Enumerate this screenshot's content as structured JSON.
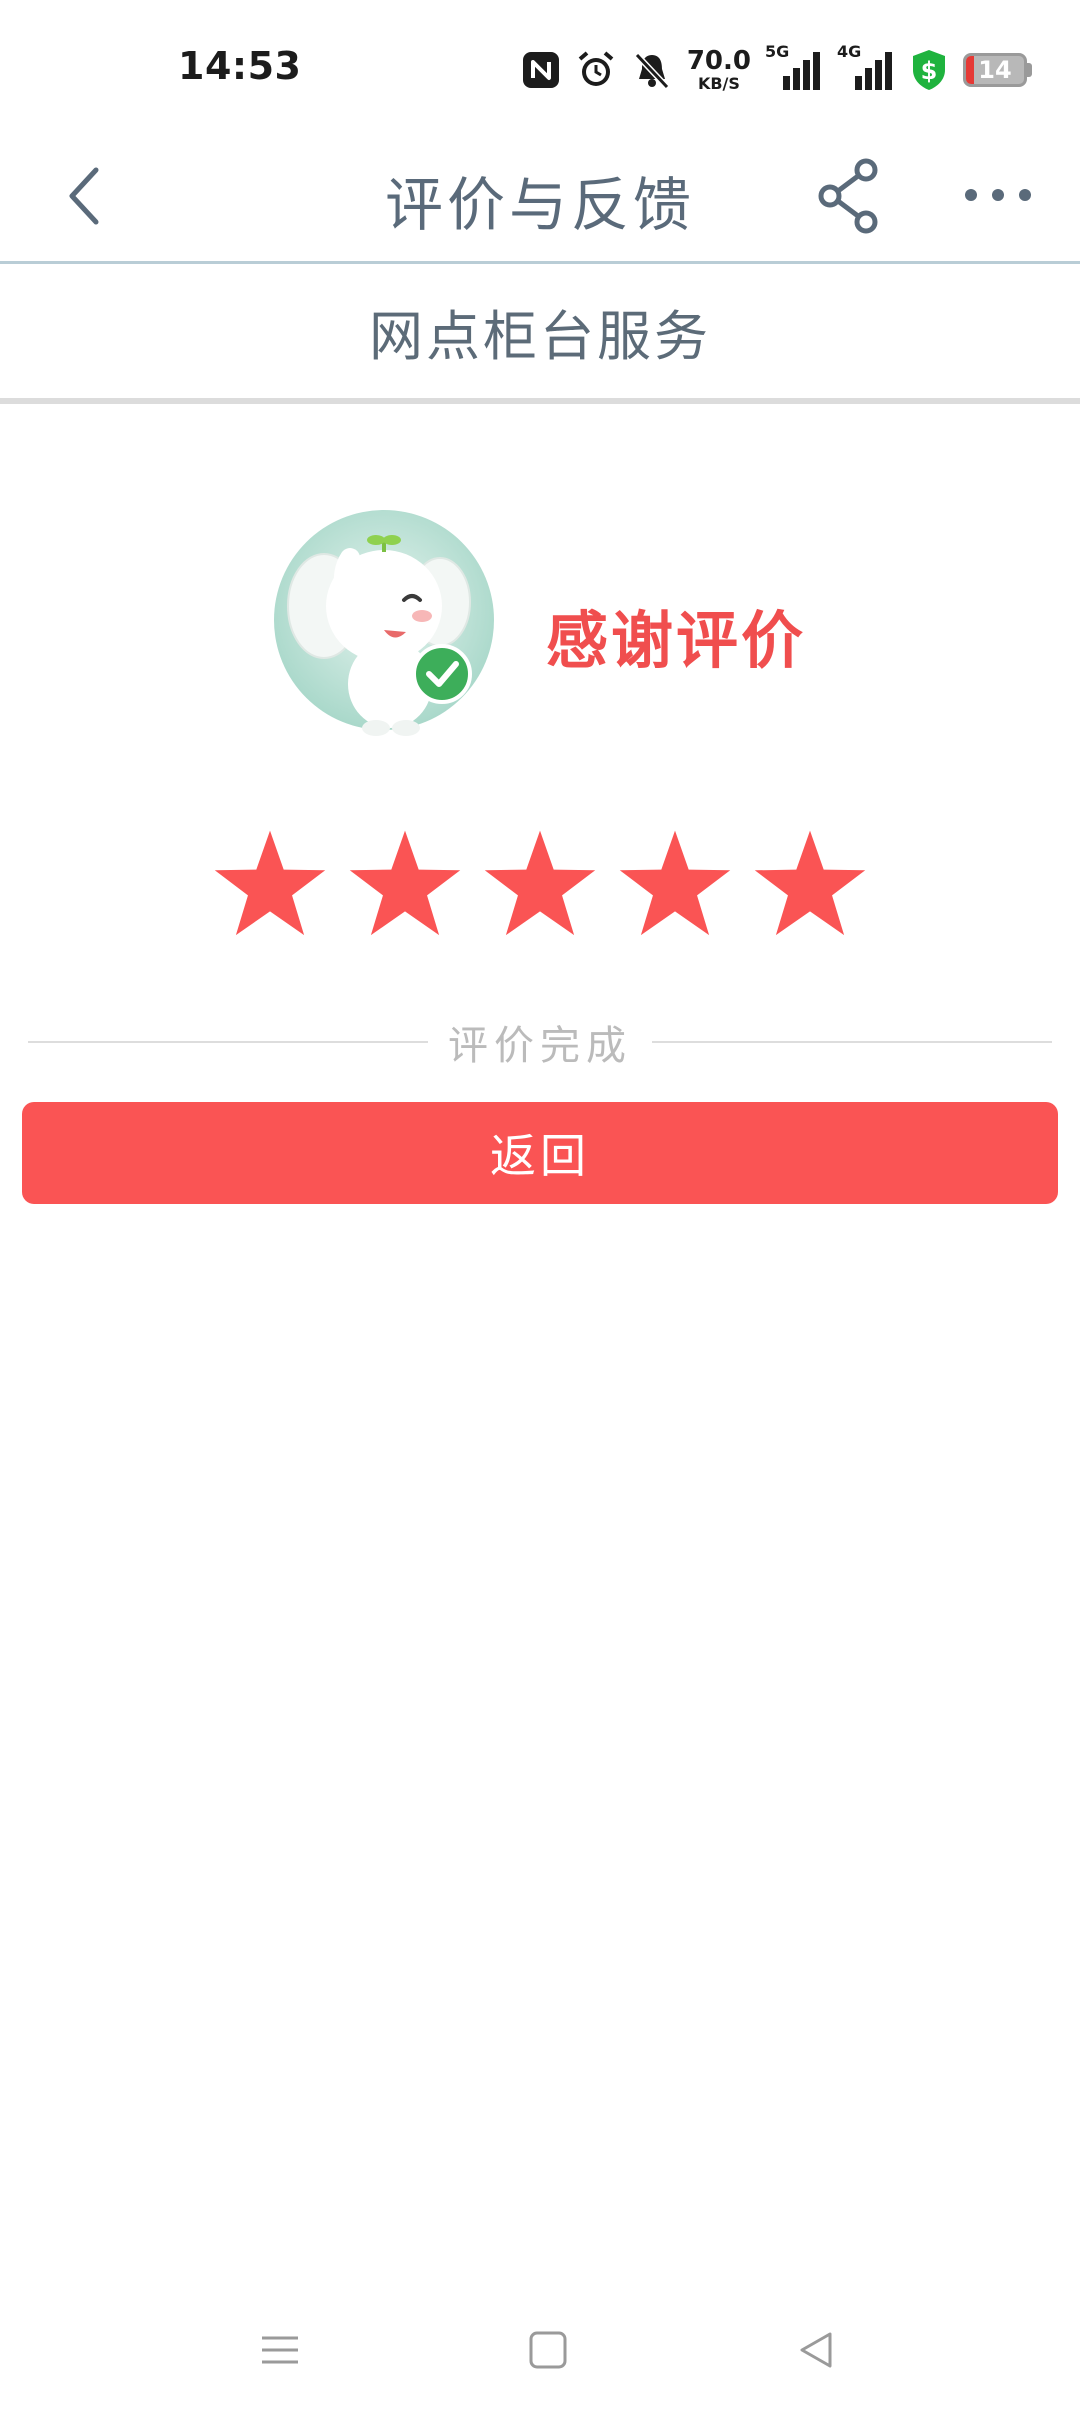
{
  "status_bar": {
    "time": "14:53",
    "net_speed_value": "70.0",
    "net_speed_unit": "KB/S",
    "signal1_label": "5G",
    "signal2_label": "4G",
    "battery_level": "14",
    "battery_fraction": 0.14,
    "icons": [
      "nfc-icon",
      "alarm-icon",
      "bell-mute-icon",
      "signal-5g-icon",
      "signal-4g-icon",
      "shield-dollar-icon",
      "battery-icon"
    ],
    "colors": {
      "shield": "#1fb33e",
      "battery_low": "#e53935"
    }
  },
  "header": {
    "title": "评价与反馈",
    "back_icon": "chevron-left-icon",
    "share_icon": "share-icon",
    "more_icon": "more-dots-icon"
  },
  "subheader": {
    "title": "网点柜台服务"
  },
  "result": {
    "thanks_text": "感谢评价",
    "rating": 5,
    "max_rating": 5,
    "done_text": "评价完成",
    "return_button": "返回",
    "accent_color": "#fa5454"
  },
  "nav_bar": {
    "icons": [
      "menu-icon",
      "home-icon",
      "back-triangle-icon"
    ]
  }
}
